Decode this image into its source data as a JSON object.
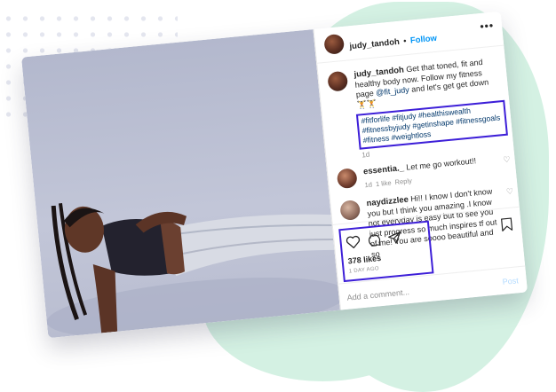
{
  "post": {
    "username": "judy_tandoh",
    "separator": "•",
    "follow_label": "Follow",
    "more_label": "•••",
    "caption_user": "judy_tandoh",
    "caption_text": "Get that toned, fit and healthy body now. Follow my fitness page",
    "caption_mention": "@fit_judy",
    "caption_tail": "and let's get get down",
    "caption_emoji": "🏋🏋",
    "hashtags": "#fitforlife #fitjudy #healthiswealth #fitnessbyjudy #getinshape #fitnessgoals #fitness #weightloss",
    "caption_time": "1d",
    "likes": "378 likes",
    "posted_ago": "1 DAY AGO",
    "add_comment_placeholder": "Add a comment...",
    "post_label": "Post"
  },
  "comments": [
    {
      "user": "essentia._",
      "text": "Let me go workout!!",
      "time": "1d",
      "likes": "1 like",
      "reply_label": "Reply"
    },
    {
      "user": "naydizzlee",
      "text": "Hi!! I know I don't know you but I think you amazing .I know not everyday is easy but to see you just progress so much inspires tf out of me! You are soooo beautiful and so"
    }
  ],
  "icons": [
    "heart-icon",
    "comment-icon",
    "share-icon",
    "bookmark-icon",
    "more-options-icon"
  ],
  "colors": {
    "highlight_box": "#3d1fd8",
    "follow_link": "#0095f6",
    "hashtag_link": "#00376b",
    "blob": "#d4f1e3"
  }
}
